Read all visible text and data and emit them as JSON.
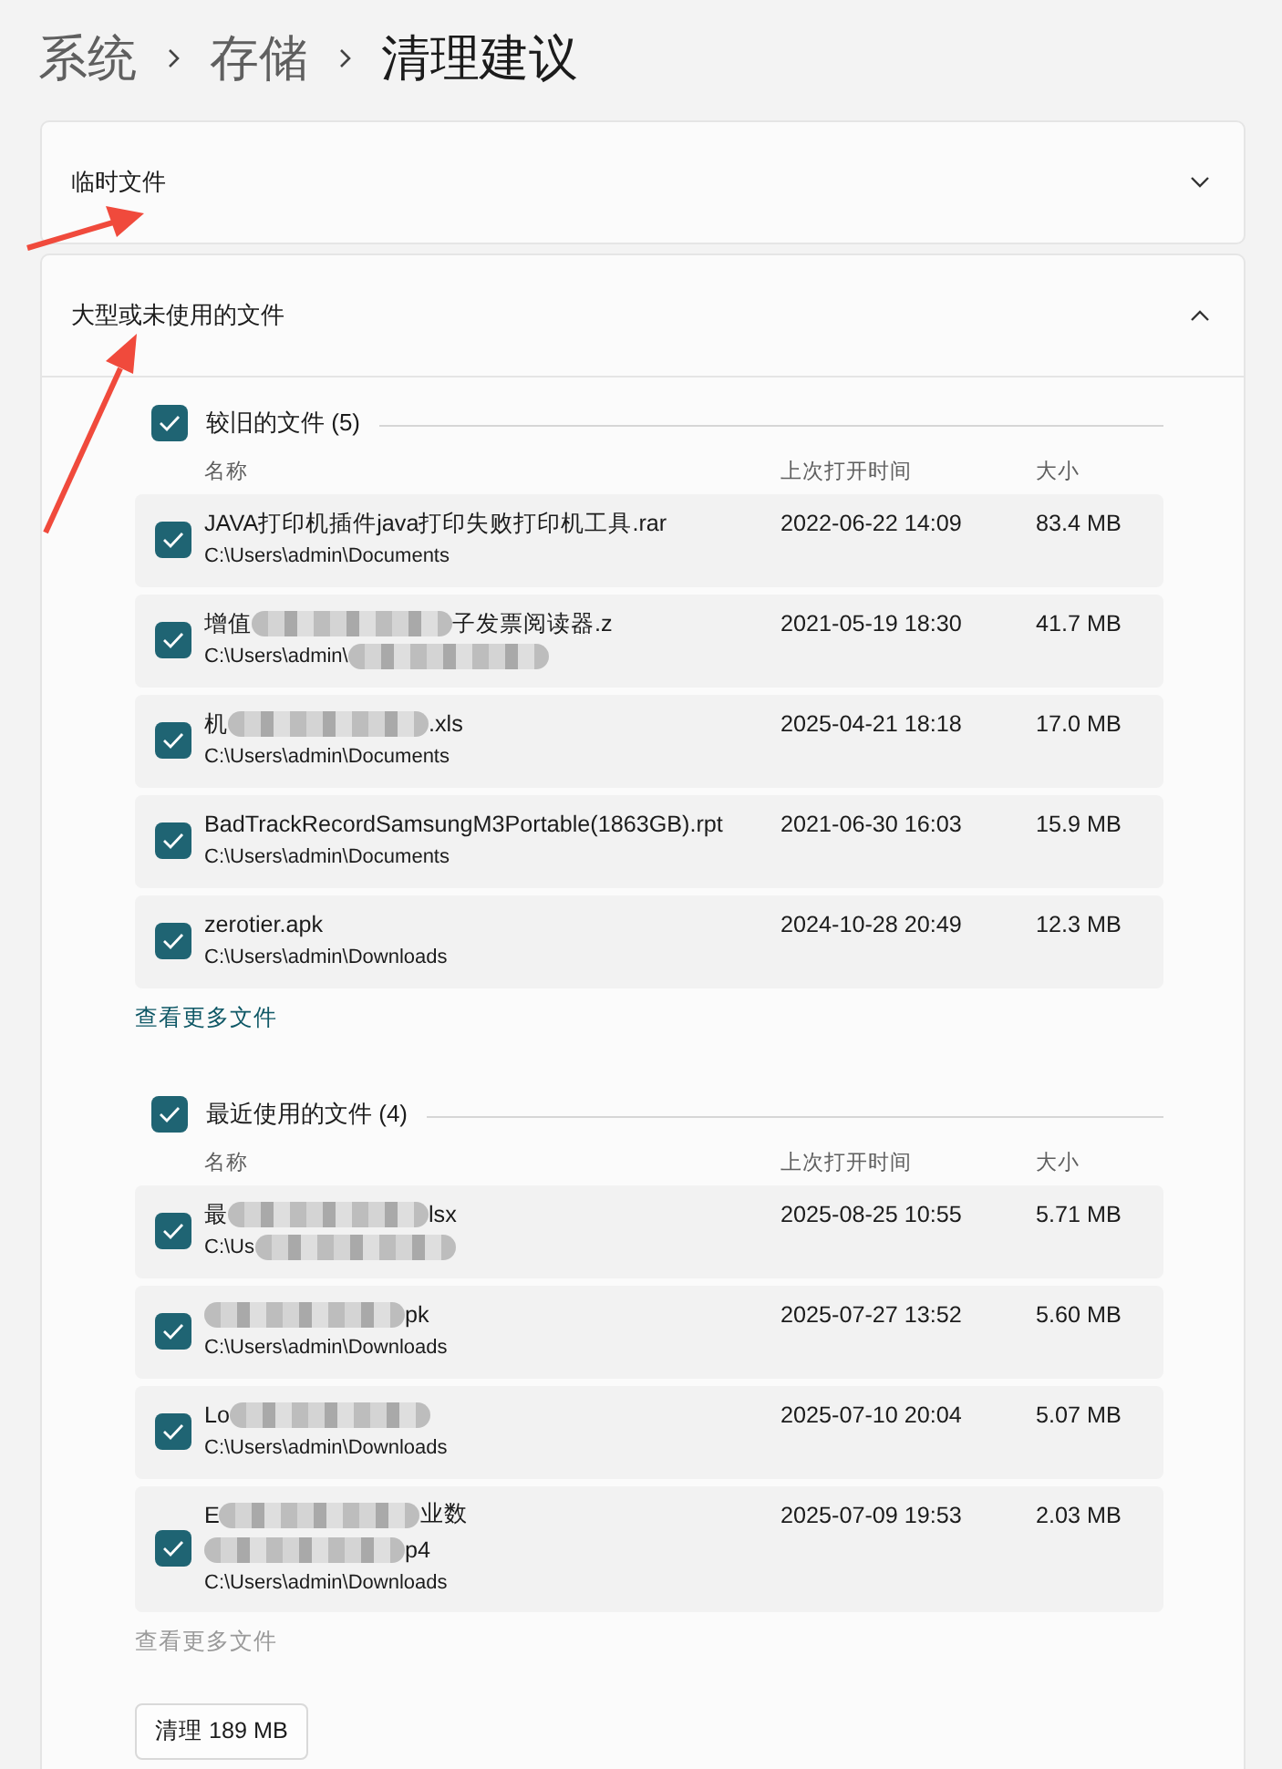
{
  "breadcrumb": [
    "系统",
    "存储",
    "清理建议"
  ],
  "sections": [
    {
      "title": "临时文件",
      "expanded": false
    },
    {
      "title": "大型或未使用的文件",
      "expanded": true,
      "groups": [
        {
          "title": "较旧的文件 (5)",
          "checked": true,
          "columns": [
            "名称",
            "上次打开时间",
            "大小"
          ],
          "rows": [
            {
              "checked": true,
              "name_lines": [
                [
                  {
                    "kind": "text",
                    "text": "JAVA打印机插件java打印失败打印机工具.rar"
                  }
                ]
              ],
              "path": [
                {
                  "kind": "text",
                  "text": "C:\\Users\\admin\\Documents"
                }
              ],
              "date": "2022-06-22 14:09",
              "size": "83.4 MB"
            },
            {
              "checked": true,
              "name_lines": [
                [
                  {
                    "kind": "text",
                    "text": "增值"
                  },
                  {
                    "kind": "blur"
                  },
                  {
                    "kind": "text",
                    "text": "子发票阅读器.z"
                  }
                ]
              ],
              "path": [
                {
                  "kind": "text",
                  "text": "C:\\Users\\admin\\"
                },
                {
                  "kind": "blur"
                }
              ],
              "date": "2021-05-19 18:30",
              "size": "41.7 MB"
            },
            {
              "checked": true,
              "name_lines": [
                [
                  {
                    "kind": "text",
                    "text": "机"
                  },
                  {
                    "kind": "blur"
                  },
                  {
                    "kind": "text",
                    "text": ".xls"
                  }
                ]
              ],
              "path": [
                {
                  "kind": "text",
                  "text": "C:\\Users\\admin\\Documents"
                }
              ],
              "date": "2025-04-21 18:18",
              "size": "17.0 MB"
            },
            {
              "checked": true,
              "name_lines": [
                [
                  {
                    "kind": "text",
                    "text": "BadTrackRecordSamsungM3Portable(1863GB).rpt"
                  }
                ]
              ],
              "path": [
                {
                  "kind": "text",
                  "text": "C:\\Users\\admin\\Documents"
                }
              ],
              "date": "2021-06-30 16:03",
              "size": "15.9 MB"
            },
            {
              "checked": true,
              "name_lines": [
                [
                  {
                    "kind": "text",
                    "text": "zerotier.apk"
                  }
                ]
              ],
              "path": [
                {
                  "kind": "text",
                  "text": "C:\\Users\\admin\\Downloads"
                }
              ],
              "date": "2024-10-28 20:49",
              "size": "12.3 MB"
            }
          ],
          "more": {
            "label": "查看更多文件",
            "disabled": false
          }
        },
        {
          "title": "最近使用的文件 (4)",
          "checked": true,
          "columns": [
            "名称",
            "上次打开时间",
            "大小"
          ],
          "rows": [
            {
              "checked": true,
              "name_lines": [
                [
                  {
                    "kind": "text",
                    "text": "最"
                  },
                  {
                    "kind": "blur"
                  },
                  {
                    "kind": "text",
                    "text": "lsx"
                  }
                ]
              ],
              "path": [
                {
                  "kind": "text",
                  "text": "C:\\Us"
                },
                {
                  "kind": "blur"
                }
              ],
              "date": "2025-08-25 10:55",
              "size": "5.71 MB"
            },
            {
              "checked": true,
              "name_lines": [
                [
                  {
                    "kind": "blur"
                  },
                  {
                    "kind": "text",
                    "text": "pk"
                  }
                ]
              ],
              "path": [
                {
                  "kind": "text",
                  "text": "C:\\Users\\admin\\Downloads"
                }
              ],
              "date": "2025-07-27 13:52",
              "size": "5.60 MB"
            },
            {
              "checked": true,
              "name_lines": [
                [
                  {
                    "kind": "text",
                    "text": "Lo"
                  },
                  {
                    "kind": "blur"
                  }
                ]
              ],
              "path": [
                {
                  "kind": "text",
                  "text": "C:\\Users\\admin\\Downloads"
                }
              ],
              "date": "2025-07-10 20:04",
              "size": "5.07 MB"
            },
            {
              "checked": true,
              "name_lines": [
                [
                  {
                    "kind": "text",
                    "text": "E"
                  },
                  {
                    "kind": "blur"
                  },
                  {
                    "kind": "text",
                    "text": "业数"
                  }
                ],
                [
                  {
                    "kind": "blur"
                  },
                  {
                    "kind": "text",
                    "text": "p4"
                  }
                ]
              ],
              "path": [
                {
                  "kind": "text",
                  "text": "C:\\Users\\admin\\Downloads"
                }
              ],
              "date": "2025-07-09 19:53",
              "size": "2.03 MB"
            }
          ],
          "more": {
            "label": "查看更多文件",
            "disabled": true
          }
        }
      ],
      "clean_button": "清理 189 MB"
    }
  ]
}
